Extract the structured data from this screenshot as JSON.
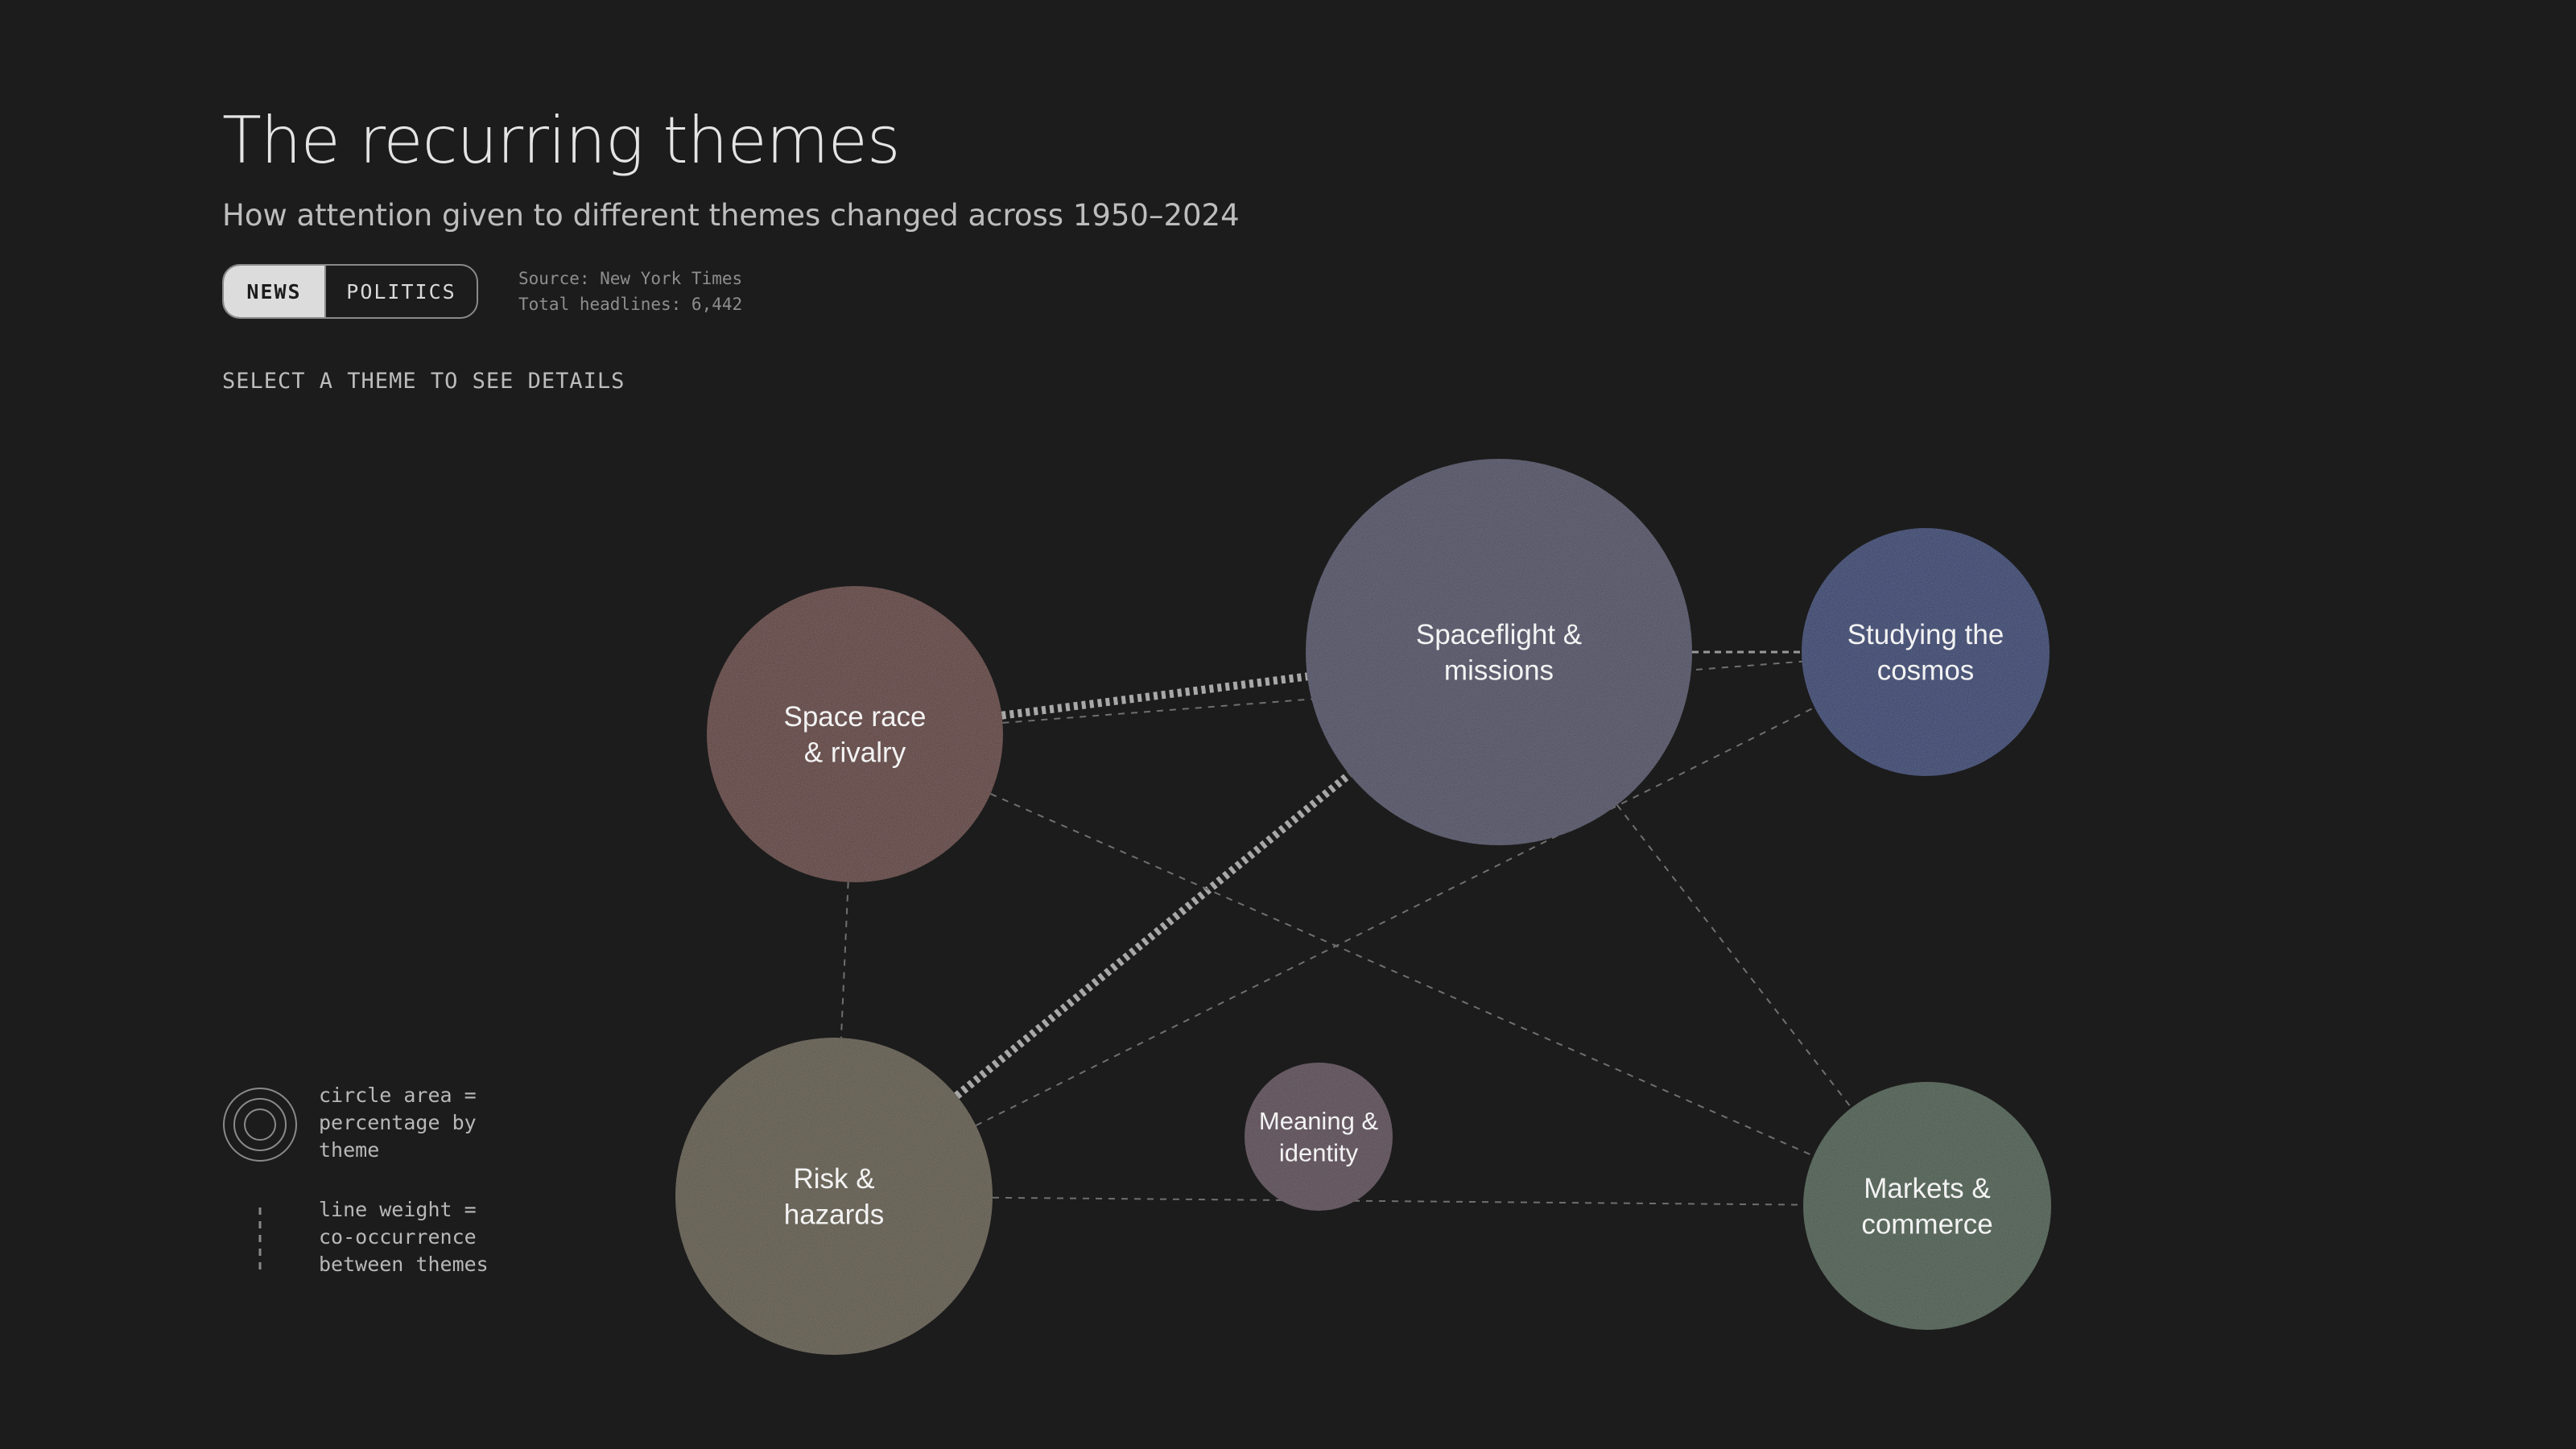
{
  "header": {
    "title": "The recurring themes",
    "subtitle": "How attention given to different themes changed across 1950–2024"
  },
  "toggle": {
    "options": [
      "NEWS",
      "POLITICS"
    ],
    "selected": "NEWS"
  },
  "meta": {
    "source": "Source: New York Times",
    "total": "Total headlines: 6,442"
  },
  "prompt": "SELECT A THEME TO SEE DETAILS",
  "legend": {
    "area_text": "circle area =\npercentage by\ntheme",
    "line_text": "line weight =\nco-occurrence\nbetween themes",
    "area_icon": "concentric-circles-icon",
    "line_icon": "dashed-line-icon"
  },
  "nodes": [
    {
      "id": "space-race",
      "label": [
        "Space race",
        "& rivalry"
      ],
      "color": "#5c3a37"
    },
    {
      "id": "spaceflight",
      "label": [
        "Spaceflight &",
        "missions"
      ],
      "color": "#4a4a60"
    },
    {
      "id": "cosmos",
      "label": [
        "Studying the",
        "cosmos"
      ],
      "color": "#2f3e6c"
    },
    {
      "id": "risk",
      "label": [
        "Risk &",
        "hazards"
      ],
      "color": "#5c5545"
    },
    {
      "id": "meaning",
      "label": [
        "Meaning &",
        "identity"
      ],
      "color": "#54434f"
    },
    {
      "id": "markets",
      "label": [
        "Markets &",
        "commerce"
      ],
      "color": "#45594a"
    }
  ],
  "links": [
    {
      "source": "space-race",
      "target": "spaceflight",
      "weight": "strong"
    },
    {
      "source": "risk",
      "target": "spaceflight",
      "weight": "strong"
    },
    {
      "source": "spaceflight",
      "target": "cosmos",
      "weight": "medium"
    },
    {
      "source": "space-race",
      "target": "risk",
      "weight": "light"
    },
    {
      "source": "space-race",
      "target": "markets",
      "weight": "light"
    },
    {
      "source": "spaceflight",
      "target": "markets",
      "weight": "light"
    },
    {
      "source": "risk",
      "target": "cosmos",
      "weight": "light"
    },
    {
      "source": "risk",
      "target": "markets",
      "weight": "light"
    },
    {
      "source": "space-race",
      "target": "cosmos",
      "weight": "light"
    }
  ]
}
